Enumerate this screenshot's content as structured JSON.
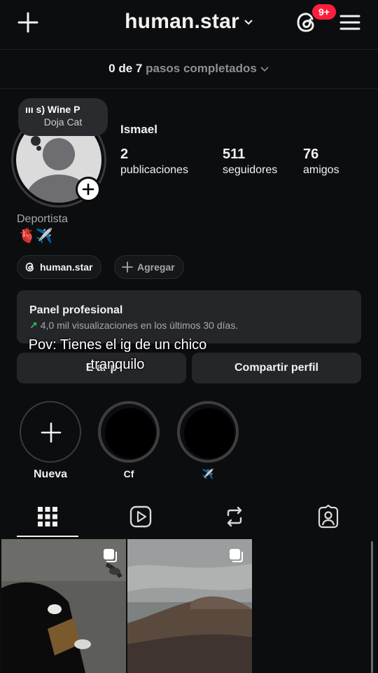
{
  "header": {
    "username": "human.star",
    "notification_count": "9+"
  },
  "onboarding": {
    "completed": "0 de 7",
    "suffix": "pasos completados"
  },
  "note": {
    "song": "ııı s)   Wine P",
    "artist": "Doja Cat"
  },
  "profile": {
    "name": "Ismael",
    "stats": [
      {
        "value": "2",
        "label": "publicaciones"
      },
      {
        "value": "511",
        "label": "seguidores"
      },
      {
        "value": "76",
        "label": "amigos"
      }
    ],
    "category": "Deportista",
    "bio_emoji": "🫀✈️"
  },
  "links": {
    "threads_handle": "human.star",
    "add_label": "Agregar"
  },
  "panel": {
    "title": "Panel profesional",
    "arrow": "↗",
    "subtitle": "4,0 mil visualizaciones en los últimos 30 días."
  },
  "buttons": {
    "edit_partial": "E  ar p",
    "share": "Compartir perfil"
  },
  "overlay_text": "Pov: Tienes el ig de un chico tranquilo",
  "highlights": [
    {
      "label": "Nueva"
    },
    {
      "label": "Cf"
    },
    {
      "label": "✈️"
    }
  ],
  "colors": {
    "background": "#0c0d0f",
    "card": "#25262a",
    "badge": "#ff1f3d",
    "trend": "#36c26a"
  }
}
